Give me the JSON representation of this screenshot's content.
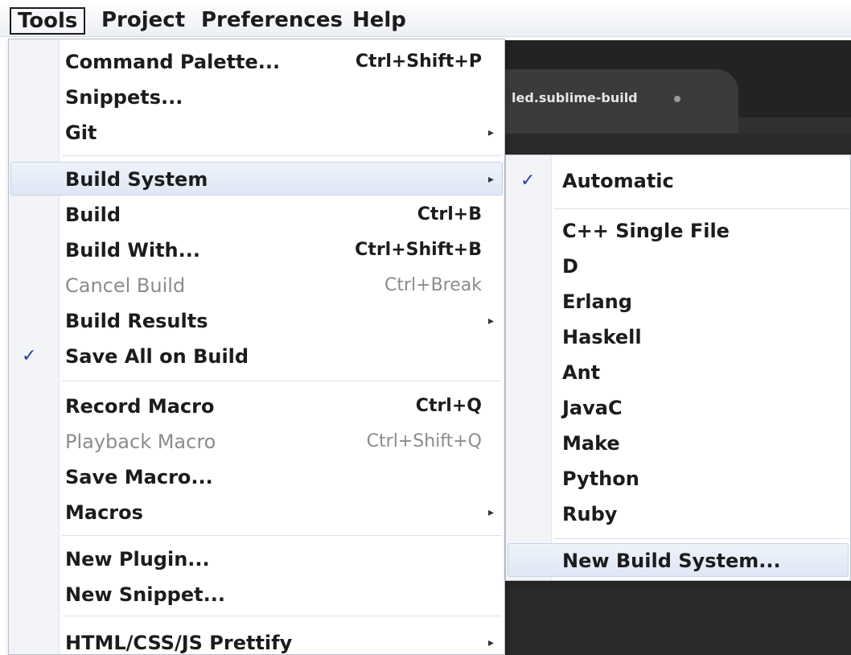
{
  "menubar": {
    "items": [
      {
        "label": "Tools",
        "active": true
      },
      {
        "label": "Project"
      },
      {
        "label": "Preferences"
      },
      {
        "label": "Help"
      }
    ]
  },
  "editor": {
    "tab_label": "led.sublime-build"
  },
  "tools_menu": {
    "command_palette": {
      "label": "Command Palette...",
      "shortcut": "Ctrl+Shift+P"
    },
    "snippets": {
      "label": "Snippets..."
    },
    "git": {
      "label": "Git"
    },
    "build_system": {
      "label": "Build System"
    },
    "build": {
      "label": "Build",
      "shortcut": "Ctrl+B"
    },
    "build_with": {
      "label": "Build With...",
      "shortcut": "Ctrl+Shift+B"
    },
    "cancel_build": {
      "label": "Cancel Build",
      "shortcut": "Ctrl+Break"
    },
    "build_results": {
      "label": "Build Results"
    },
    "save_all_on_build": {
      "label": "Save All on Build",
      "checked": true
    },
    "record_macro": {
      "label": "Record Macro",
      "shortcut": "Ctrl+Q"
    },
    "playback_macro": {
      "label": "Playback Macro",
      "shortcut": "Ctrl+Shift+Q"
    },
    "save_macro": {
      "label": "Save Macro..."
    },
    "macros": {
      "label": "Macros"
    },
    "new_plugin": {
      "label": "New Plugin..."
    },
    "new_snippet": {
      "label": "New Snippet..."
    },
    "prettify": {
      "label": "HTML/CSS/JS Prettify"
    }
  },
  "build_system_menu": {
    "automatic": {
      "label": "Automatic",
      "checked": true
    },
    "systems": [
      "C++ Single File",
      "D",
      "Erlang",
      "Haskell",
      "Ant",
      "JavaC",
      "Make",
      "Python",
      "Ruby"
    ],
    "new_build_system": {
      "label": "New Build System..."
    }
  },
  "glyphs": {
    "check": "✓",
    "submenu_arrow": "▸"
  },
  "colors": {
    "check": "#2b3f9e",
    "disabled_text": "#8c8c8c",
    "editor_bg": "#303030"
  }
}
